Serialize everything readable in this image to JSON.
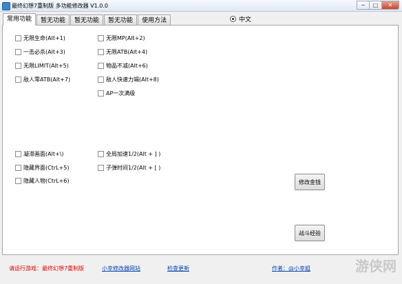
{
  "window": {
    "title": "最终幻想7重制版 多功能修改器 V1.0.0",
    "controls": {
      "minimize": "−",
      "maximize": "□",
      "close": "✕"
    }
  },
  "tabs": [
    "常用功能",
    "暂无功能",
    "暂无功能",
    "暂无功能",
    "使用方法"
  ],
  "language": {
    "label": "中文"
  },
  "options_left_top": [
    "无限生命(Alt+1)",
    "一击必杀(Alt+3)",
    "无限LIMIT(Alt+5)",
    "敌人零ATB(Alt+7)"
  ],
  "options_right_top": [
    "无限MP(Alt+2)",
    "无限ATB(Alt+4)",
    "物品不减(Alt+6)",
    "敌人快速力竭(Alt+8)",
    "AP一次满级"
  ],
  "options_left_bottom": [
    "凝滞画面(Alt+\\)",
    "隐藏界面(CtrL+5)",
    "隐藏人物(CtrL+6)"
  ],
  "options_right_bottom": [
    "全局加速1/2(Alt + ] )",
    "子弹时间1/2(Alt + [ )"
  ],
  "buttons": {
    "money": "修改金钱",
    "battle_exp": "战斗经验"
  },
  "footer": {
    "run_game": "请运行游戏：最终幻想7重制版",
    "site": "小幸修改器网站",
    "update": "检查更新",
    "author": "作者：@小幸姐"
  },
  "watermark": "游侠网"
}
